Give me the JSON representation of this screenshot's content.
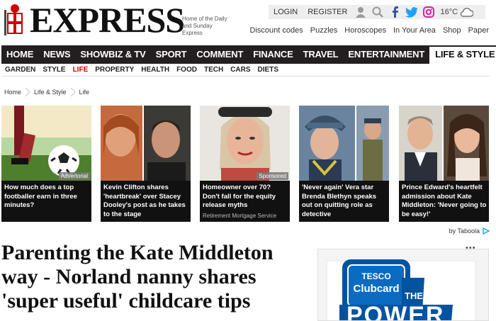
{
  "header": {
    "logo_text": "EXPRESS",
    "tagline": "Home of the Daily and Sunday Express",
    "login": "LOGIN",
    "register": "REGISTER",
    "temperature": "16°C",
    "subnav": [
      "Discount codes",
      "Puzzles",
      "Horoscopes",
      "In Your Area",
      "Shop",
      "Paper"
    ]
  },
  "mainnav": [
    "HOME",
    "NEWS",
    "SHOWBIZ & TV",
    "SPORT",
    "COMMENT",
    "FINANCE",
    "TRAVEL",
    "ENTERTAINMENT",
    "LIFE & STYLE"
  ],
  "secnav": [
    "GARDEN",
    "STYLE",
    "LIFE",
    "PROPERTY",
    "HEALTH",
    "FOOD",
    "TECH",
    "CARS",
    "DIETS"
  ],
  "breadcrumb": [
    "Home",
    "Life & Style",
    "Life"
  ],
  "cards": [
    {
      "caption": "How much does a top footballer earn in three minutes?",
      "tag": "Advertorial",
      "sponsor": ""
    },
    {
      "caption": "Kevin Clifton shares 'heartbreak' over Stacey Dooley's post as he takes to the stage",
      "tag": "",
      "sponsor": ""
    },
    {
      "caption": "Homeowner over 70? Don't fall for the equity release myths",
      "tag": "Sponsored",
      "sponsor": "Retirement Mortgage Service"
    },
    {
      "caption": "'Never again' Vera star Brenda Blethyn speaks out on quitting role as detective",
      "tag": "",
      "sponsor": ""
    },
    {
      "caption": "Prince Edward's heartfelt admission about Kate Middleton: 'Never going to be easy!'",
      "tag": "",
      "sponsor": ""
    }
  ],
  "taboola": "by Taboola",
  "headline": "Parenting the Kate Middleton way - Norland nanny shares 'super useful' childcare tips",
  "ad": {
    "brand": "TESCO",
    "program": "Clubcard",
    "promo_word_1": "THE",
    "promo_word_2": "POWER",
    "dots": "•••"
  },
  "colors": {
    "nav_bg": "#231f20",
    "accent_red": "#cc0000",
    "twitter_blue": "#1da1f2",
    "facebook_blue": "#3b5998",
    "tesco_blue": "#00539f"
  }
}
